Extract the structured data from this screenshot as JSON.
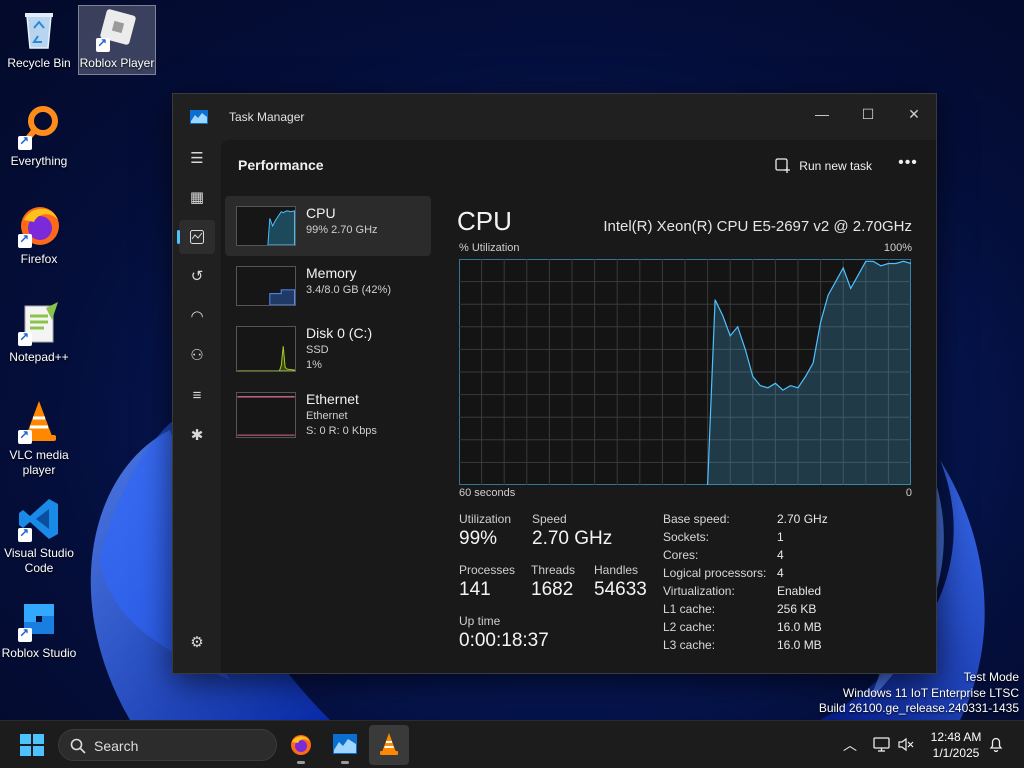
{
  "desktop": {
    "icons": [
      {
        "label": "Recycle Bin"
      },
      {
        "label": "Roblox Player"
      },
      {
        "label": "Everything"
      },
      {
        "label": "Firefox"
      },
      {
        "label": "Notepad++"
      },
      {
        "label": "VLC media player"
      },
      {
        "label": "Visual Studio Code"
      },
      {
        "label": "Roblox Studio"
      }
    ]
  },
  "window": {
    "title": "Task Manager",
    "page_title": "Performance",
    "run_new_task": "Run new task",
    "more": "•••"
  },
  "resources": [
    {
      "name": "CPU",
      "sub1": "99%  2.70 GHz",
      "sub2": ""
    },
    {
      "name": "Memory",
      "sub1": "3.4/8.0 GB (42%)",
      "sub2": ""
    },
    {
      "name": "Disk 0 (C:)",
      "sub1": "SSD",
      "sub2": "1%"
    },
    {
      "name": "Ethernet",
      "sub1": "Ethernet",
      "sub2": "S: 0  R: 0 Kbps"
    }
  ],
  "cpu": {
    "heading": "CPU",
    "model": "Intel(R) Xeon(R) CPU E5-2697 v2 @ 2.70GHz",
    "y_label": "% Utilization",
    "y_max_label": "100%",
    "x_left_label": "60 seconds",
    "x_right_label": "0",
    "stats": {
      "utilization_label": "Utilization",
      "utilization": "99%",
      "speed_label": "Speed",
      "speed": "2.70 GHz",
      "processes_label": "Processes",
      "processes": "141",
      "threads_label": "Threads",
      "threads": "1682",
      "handles_label": "Handles",
      "handles": "54633",
      "uptime_label": "Up time",
      "uptime": "0:00:18:37"
    },
    "specs": [
      {
        "k": "Base speed:",
        "v": "2.70 GHz"
      },
      {
        "k": "Sockets:",
        "v": "1"
      },
      {
        "k": "Cores:",
        "v": "4"
      },
      {
        "k": "Logical processors:",
        "v": "4"
      },
      {
        "k": "Virtualization:",
        "v": "Enabled"
      },
      {
        "k": "L1 cache:",
        "v": "256 KB"
      },
      {
        "k": "L2 cache:",
        "v": "16.0 MB"
      },
      {
        "k": "L3 cache:",
        "v": "16.0 MB"
      }
    ]
  },
  "chart_data": {
    "type": "area",
    "x": [
      60,
      57,
      54,
      51,
      48,
      45,
      42,
      39,
      36,
      34,
      33,
      32,
      31,
      30,
      29,
      28,
      27,
      26,
      25,
      24,
      23,
      22,
      21,
      20,
      19,
      18,
      17,
      16,
      15,
      14,
      13,
      12,
      11,
      10,
      9,
      8,
      7,
      6,
      5,
      4,
      3,
      2,
      1,
      0
    ],
    "values": [
      null,
      null,
      null,
      null,
      null,
      null,
      null,
      null,
      null,
      null,
      null,
      null,
      null,
      null,
      null,
      null,
      0,
      82,
      75,
      66,
      70,
      60,
      48,
      44,
      43,
      45,
      42,
      44,
      43,
      48,
      54,
      72,
      84,
      90,
      96,
      87,
      93,
      99,
      99,
      97,
      98,
      98,
      99,
      98
    ],
    "ylim": [
      0,
      100
    ],
    "color": "#4cc2ff"
  },
  "watermark": {
    "line1": "Test Mode",
    "line2": "Windows 11 IoT Enterprise LTSC",
    "line3": "Build 26100.ge_release.240331-1435"
  },
  "taskbar": {
    "search_placeholder": "Search",
    "time": "12:48 AM",
    "date": "1/1/2025"
  }
}
